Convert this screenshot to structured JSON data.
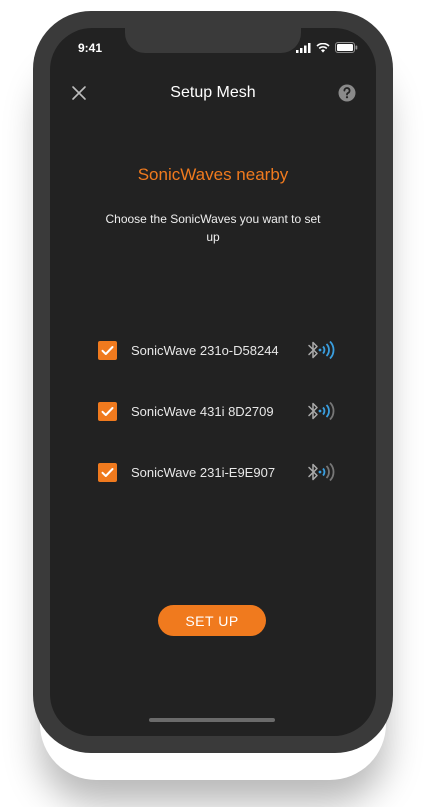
{
  "status_bar": {
    "time": "9:41"
  },
  "header": {
    "title": "Setup Mesh"
  },
  "main": {
    "heading": "SonicWaves nearby",
    "subtitle": "Choose the SonicWaves you want to set up",
    "devices": [
      {
        "name": "SonicWave 231o-D58244",
        "checked": true,
        "signal_bars": 3
      },
      {
        "name": "SonicWave 431i 8D2709",
        "checked": true,
        "signal_bars": 2
      },
      {
        "name": "SonicWave 231i-E9E907",
        "checked": true,
        "signal_bars": 1
      }
    ],
    "setup_button": "SET UP"
  },
  "colors": {
    "accent": "#f07a1e",
    "background": "#222222",
    "signal_active": "#3a9fe0",
    "signal_inactive": "#777777"
  }
}
